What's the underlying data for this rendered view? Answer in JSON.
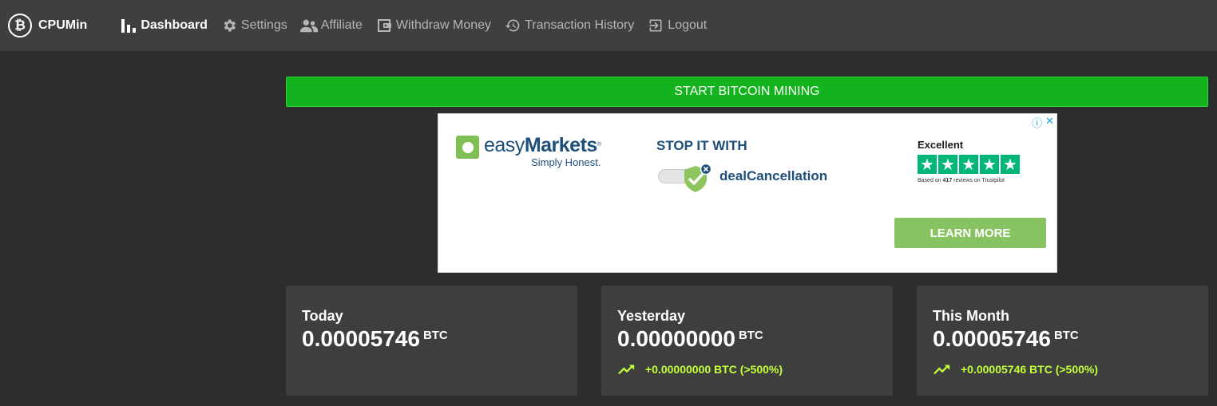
{
  "brand": {
    "logo_glyph": "₿",
    "name": "CPUMin"
  },
  "nav": [
    {
      "label": "Dashboard",
      "icon": "bar-chart-icon",
      "active": true
    },
    {
      "label": "Settings",
      "icon": "gear-icon"
    },
    {
      "label": "Affiliate",
      "icon": "people-icon"
    },
    {
      "label": "Withdraw Money",
      "icon": "wallet-icon"
    },
    {
      "label": "Transaction History",
      "icon": "history-icon"
    },
    {
      "label": "Logout",
      "icon": "logout-icon"
    }
  ],
  "start_button": {
    "label": "START BITCOIN MINING"
  },
  "ad": {
    "corner_info": "ⓘ",
    "corner_close": "✕",
    "brand_name_light": "easy",
    "brand_name_bold": "Markets",
    "brand_sup": "®",
    "slogan": "Simply Honest.",
    "headline": "STOP IT WITH",
    "feature": "dealCancellation",
    "rating_label": "Excellent",
    "star_glyph": "★",
    "reviews_prefix": "Based on ",
    "reviews_count": "417",
    "reviews_suffix": " reviews on Trustpilot",
    "cta": "LEARN MORE",
    "colors": {
      "brand": "#1d4f7c",
      "green": "#87c363",
      "trustpilot": "#00b67a"
    }
  },
  "cards": [
    {
      "title": "Today",
      "value": "0.00005746",
      "unit": "BTC"
    },
    {
      "title": "Yesterday",
      "value": "0.00000000",
      "unit": "BTC",
      "change": "+0.00000000 BTC (>500%)"
    },
    {
      "title": "This Month",
      "value": "0.00005746",
      "unit": "BTC",
      "change": "+0.00005746 BTC (>500%)"
    }
  ],
  "colors": {
    "accent_green": "#12b31c",
    "trend": "#c3ff3a",
    "navbar": "#3f3f3f",
    "background": "#2d2d2d"
  }
}
